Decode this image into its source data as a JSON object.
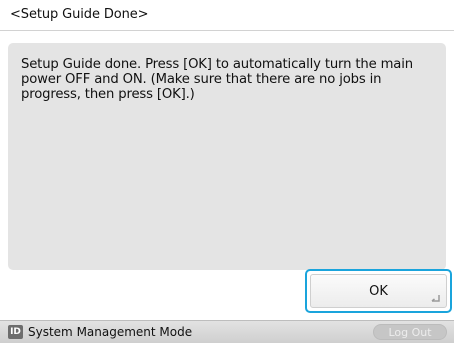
{
  "header": {
    "title": "<Setup Guide Done>"
  },
  "message": {
    "text": "Setup Guide done. Press [OK] to automatically turn the main\npower OFF and ON. (Make sure that there are no jobs in\nprogress, then press [OK].)"
  },
  "actions": {
    "ok_label": "OK"
  },
  "status_bar": {
    "id_badge": "ID",
    "mode_label": "System Management Mode",
    "logout_label": "Log Out",
    "logout_enabled": false
  },
  "colors": {
    "focus_outline": "#1aa4dc",
    "panel_background": "#e4e4e4"
  }
}
